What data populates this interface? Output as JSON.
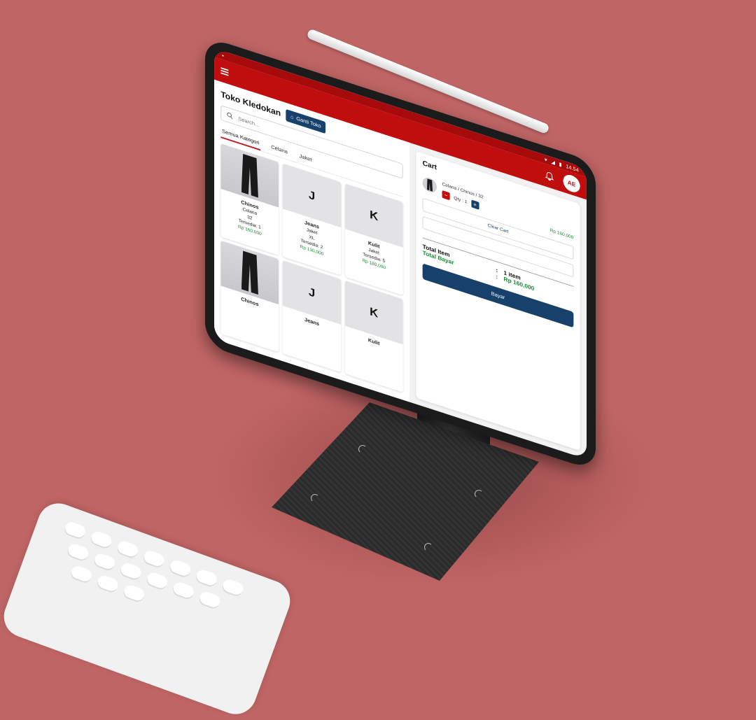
{
  "status_bar": {
    "time": "14.54"
  },
  "app_bar": {
    "avatar_initials": "AE"
  },
  "store": {
    "name": "Toko Kledokan",
    "switch_label": "Ganti Toko"
  },
  "search": {
    "placeholder": "Search..."
  },
  "tabs": [
    {
      "label": "Semua Kategori",
      "active": true
    },
    {
      "label": "Celana",
      "active": false
    },
    {
      "label": "Jaket",
      "active": false
    }
  ],
  "products": [
    {
      "thumb": "photo",
      "name": "Chinos",
      "category": "Celana",
      "size": "32",
      "stock": "Tersedia: 1",
      "price": "Rp 160,000"
    },
    {
      "thumb": "J",
      "name": "Jeans",
      "category": "Jaket",
      "size": "XL",
      "stock": "Tersedia: 2",
      "price": "Rp 130,000"
    },
    {
      "thumb": "K",
      "name": "Kulit",
      "category": "Jaket",
      "size": "",
      "stock": "Tersedia: 5",
      "price": "Rp 180,000"
    },
    {
      "thumb": "photo",
      "name": "Chinos",
      "category": "",
      "size": "",
      "stock": "",
      "price": ""
    },
    {
      "thumb": "J",
      "name": "Jeans",
      "category": "",
      "size": "",
      "stock": "",
      "price": ""
    },
    {
      "thumb": "K",
      "name": "Kulit",
      "category": "",
      "size": "",
      "stock": "",
      "price": ""
    }
  ],
  "cart": {
    "title": "Cart",
    "item": {
      "name": "Celana / Chinos / 32",
      "qty_label": "Qty : 1",
      "price": "Rp 160,000",
      "minus": "−",
      "plus": "+"
    },
    "clear_label": "Clear Cart",
    "total_item_label": "Total Item",
    "total_item_value": "1 item",
    "total_pay_label": "Total Bayar",
    "total_pay_value": "Rp 160,000",
    "separator": ":",
    "pay_label": "Bayar"
  },
  "colors": {
    "background": "#c06565",
    "brand_red": "#c00d0d",
    "navy": "#17406b",
    "price_green": "#1a8b34"
  }
}
